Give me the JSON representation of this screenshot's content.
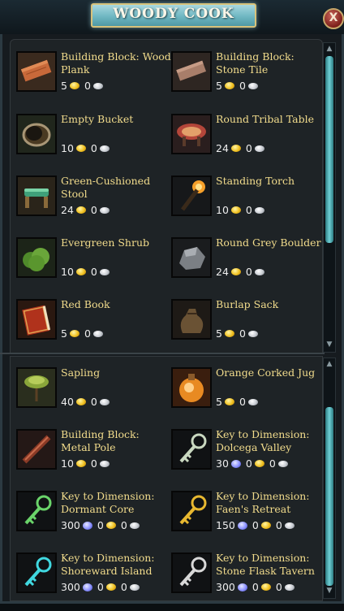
{
  "window": {
    "title": "WOODY COOK",
    "close_glyph": "X"
  },
  "items": [
    {
      "name": "Building Block: Wood Plank",
      "icon": "wood-plank-icon",
      "price": [
        "5",
        "0"
      ]
    },
    {
      "name": "Building Block: Stone Tile",
      "icon": "stone-tile-icon",
      "price": [
        "5",
        "0"
      ]
    },
    {
      "name": "Empty Bucket",
      "icon": "bucket-icon",
      "price": [
        "10",
        "0"
      ]
    },
    {
      "name": "Round Tribal Table",
      "icon": "tribal-table-icon",
      "price": [
        "24",
        "0"
      ]
    },
    {
      "name": "Green-Cushioned Stool",
      "icon": "stool-icon",
      "price": [
        "24",
        "0"
      ]
    },
    {
      "name": "Standing Torch",
      "icon": "torch-icon",
      "price": [
        "10",
        "0"
      ]
    },
    {
      "name": "Evergreen Shrub",
      "icon": "shrub-icon",
      "price": [
        "10",
        "0"
      ]
    },
    {
      "name": "Round Grey Boulder",
      "icon": "boulder-icon",
      "price": [
        "24",
        "0"
      ]
    },
    {
      "name": "Red Book",
      "icon": "red-book-icon",
      "price": [
        "5",
        "0"
      ]
    },
    {
      "name": "Burlap Sack",
      "icon": "sack-icon",
      "price": [
        "5",
        "0"
      ]
    },
    {
      "name": "Sapling",
      "icon": "sapling-icon",
      "price": [
        "40",
        "0"
      ]
    },
    {
      "name": "Orange Corked Jug",
      "icon": "jug-icon",
      "price": [
        "5",
        "0"
      ]
    },
    {
      "name": "Building Block: Metal Pole",
      "icon": "metal-pole-icon",
      "price": [
        "10",
        "0"
      ]
    },
    {
      "name": "Key to Dimension: Dolcega Valley",
      "icon": "key-icon",
      "price": [
        "30",
        "0",
        "0"
      ]
    },
    {
      "name": "Key to Dimension: Dormant Core",
      "icon": "key-icon",
      "price": [
        "300",
        "0",
        "0"
      ]
    },
    {
      "name": "Key to Dimension: Faen's Retreat",
      "icon": "key-icon",
      "price": [
        "150",
        "0",
        "0"
      ]
    },
    {
      "name": "Key to Dimension: Shoreward Island",
      "icon": "key-icon",
      "price": [
        "300",
        "0",
        "0"
      ]
    },
    {
      "name": "Key to Dimension: Stone Flask Tavern",
      "icon": "key-icon",
      "price": [
        "300",
        "0",
        "0"
      ]
    }
  ],
  "currency_icons": [
    "gem-icon",
    "gold-coin-icon",
    "silver-coin-icon"
  ],
  "colors": {
    "title_plate": "#7fc6cf",
    "item_name": "#f2dc8c",
    "panel": "#1e2326",
    "scroll_thumb": "#4fb3ba"
  }
}
